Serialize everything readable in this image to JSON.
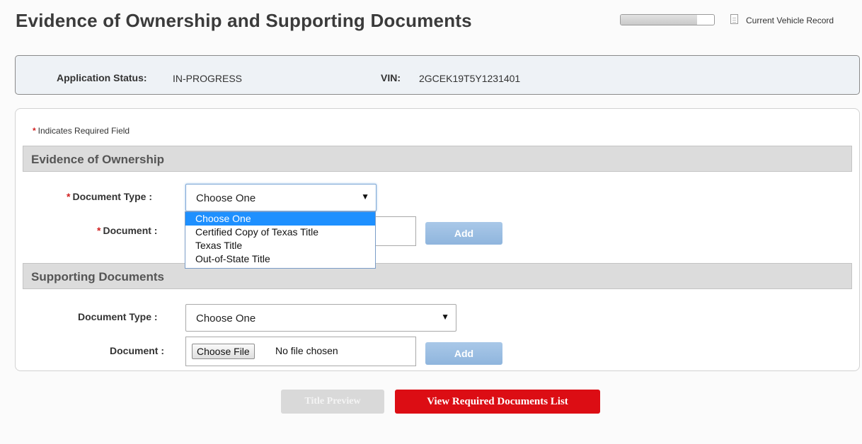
{
  "header": {
    "title": "Evidence of Ownership and Supporting Documents",
    "progress_fraction": 0.82,
    "record_link_label": "Current Vehicle Record",
    "record_icon": "document-icon"
  },
  "status": {
    "app_status_label": "Application Status:",
    "app_status_value": "IN-PROGRESS",
    "vin_label": "VIN:",
    "vin_value": "2GCEK19T5Y1231401"
  },
  "form": {
    "required_star": "*",
    "required_note": "Indicates Required Field",
    "evidence": {
      "section_title": "Evidence of Ownership",
      "doc_type_label": "Document Type :",
      "doc_type_selected": "Choose One",
      "doc_label": "Document :",
      "add_label": "Add",
      "dropdown_options": [
        "Choose One",
        "Certified Copy of Texas Title",
        "Texas Title",
        "Out-of-State Title"
      ]
    },
    "supporting": {
      "section_title": "Supporting Documents",
      "doc_type_label": "Document Type :",
      "doc_type_selected": "Choose One",
      "doc_label": "Document :",
      "choose_file_label": "Choose File",
      "file_status": "No file chosen",
      "add_label": "Add"
    }
  },
  "footer": {
    "title_preview_label": "Title Preview",
    "required_docs_label": "View Required Documents List"
  },
  "colors": {
    "primary_red": "#dc0d14",
    "add_button_blue": "#9fc0e3",
    "dropdown_highlight": "#1e90ff",
    "required_star": "#d11f1f"
  }
}
